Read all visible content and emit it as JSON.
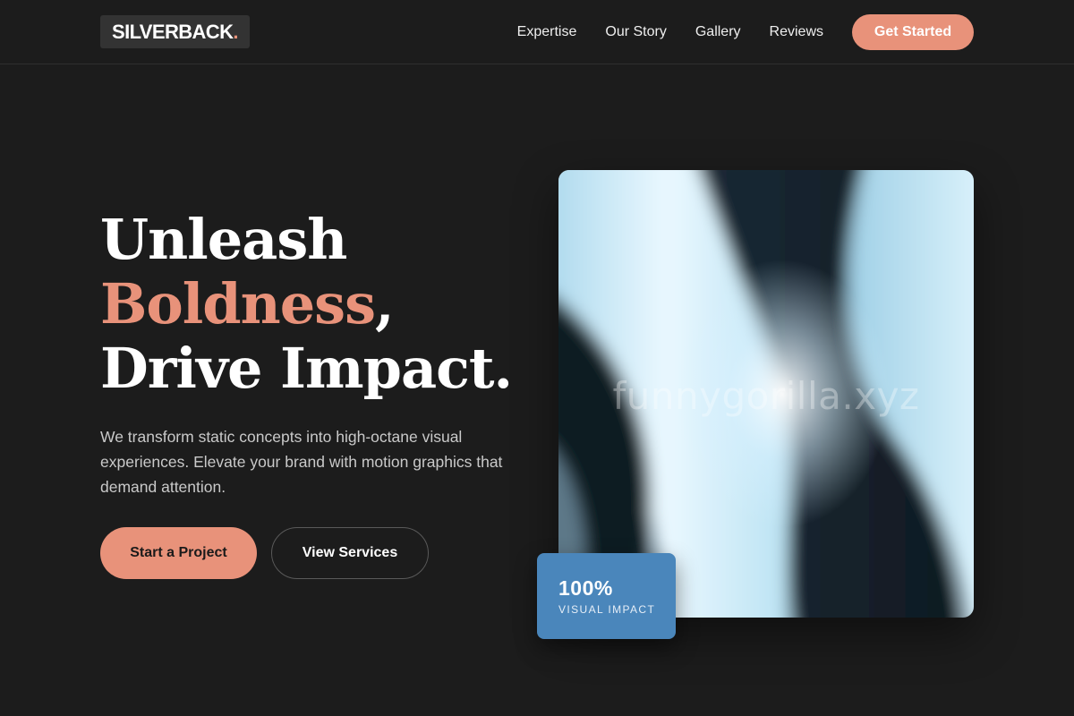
{
  "header": {
    "logo_text": "SILVERBACK",
    "logo_dot": ".",
    "nav": [
      {
        "label": "Expertise"
      },
      {
        "label": "Our Story"
      },
      {
        "label": "Gallery"
      },
      {
        "label": "Reviews"
      }
    ],
    "cta_label": "Get Started"
  },
  "hero": {
    "headline_line1": "Unleash",
    "headline_accent": "Boldness",
    "headline_comma": ",",
    "headline_line3": "Drive Impact.",
    "subtitle": "We transform static concepts into high-octane visual experiences. Elevate your brand with motion graphics that demand attention.",
    "primary_button": "Start a Project",
    "secondary_button": "View Services",
    "watermark": "funnygorilla.xyz",
    "stat_value": "100%",
    "stat_label": "VISUAL IMPACT"
  },
  "colors": {
    "background": "#1c1c1c",
    "accent": "#e8927a",
    "stat_card": "#4a86bb"
  }
}
